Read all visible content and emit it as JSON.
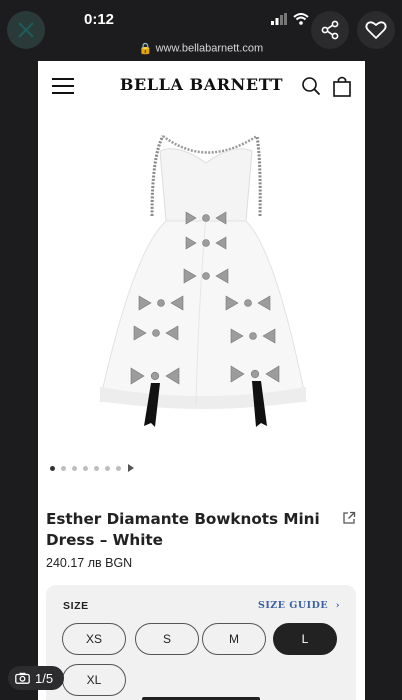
{
  "status": {
    "time": "0:12"
  },
  "browser": {
    "url": "www.bellabarnett.com"
  },
  "site": {
    "brand": "BELLA BARNETT"
  },
  "product": {
    "title": "Esther Diamante Bowknots Mini Dress – White",
    "price": "240.17 лв BGN",
    "image_count": 7
  },
  "sizes": {
    "label": "SIZE",
    "guide_label": "SIZE GUIDE",
    "options": [
      "XS",
      "S",
      "M",
      "L",
      "XL"
    ],
    "selected": "L"
  },
  "gallery": {
    "counter": "1/5"
  },
  "icons": {
    "close": "close-icon",
    "share": "share-icon",
    "favorite": "heart-icon",
    "menu": "hamburger-icon",
    "search": "search-icon",
    "cart": "shopping-bag-icon",
    "external": "external-link-icon",
    "camera": "camera-icon"
  },
  "colors": {
    "accent_link": "#3b5fa8",
    "selected_chip": "#222222"
  }
}
